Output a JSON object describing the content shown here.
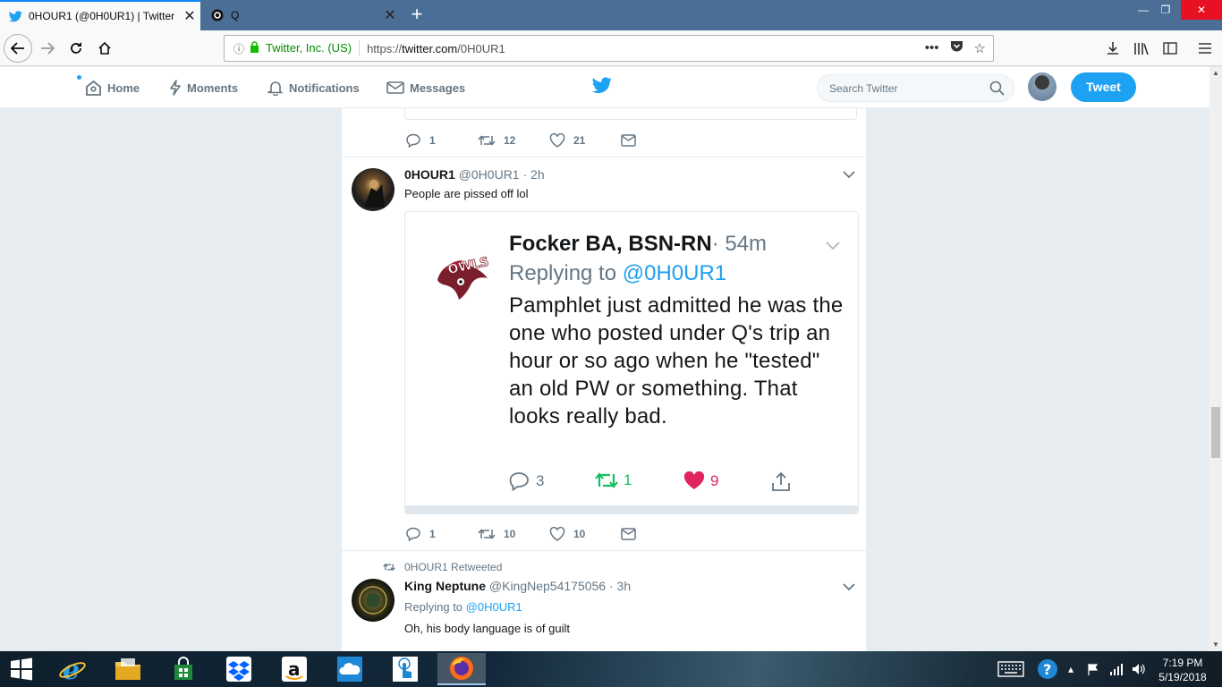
{
  "browser": {
    "tabs": [
      {
        "title": "0HOUR1 (@0H0UR1) | Twitter",
        "active": true
      },
      {
        "title": "Q",
        "active": false
      }
    ],
    "identity": "Twitter, Inc. (US)",
    "url_prefix": "https://",
    "url_host": "twitter.com",
    "url_path": "/0H0UR1",
    "page_actions_icon": "•••"
  },
  "twitter_header": {
    "nav": [
      {
        "label": "Home",
        "icon": "home-icon"
      },
      {
        "label": "Moments",
        "icon": "lightning-icon"
      },
      {
        "label": "Notifications",
        "icon": "bell-icon"
      },
      {
        "label": "Messages",
        "icon": "envelope-icon"
      }
    ],
    "search_placeholder": "Search Twitter",
    "tweet_button": "Tweet"
  },
  "prev_tweet_actions": {
    "replies": "1",
    "retweets": "12",
    "likes": "21"
  },
  "tweet1": {
    "fullname": "0HOUR1",
    "handle": "@0H0UR1",
    "time": "· 2h",
    "text": "People are pissed off lol",
    "actions": {
      "replies": "1",
      "retweets": "10",
      "likes": "10"
    },
    "embedded": {
      "name": "Focker BA, BSN-RN",
      "time": "· 54m",
      "replying_prefix": "Replying to",
      "replying_to": "@0H0UR1",
      "text": "Pamphlet just admitted he was the one who posted under Q's trip an hour or so ago when he \"tested\" an old PW or something. That looks really bad.",
      "replies": "3",
      "retweets": "1",
      "likes": "9"
    }
  },
  "tweet2": {
    "retweeted_by": "0HOUR1 Retweeted",
    "fullname": "King Neptune",
    "handle": "@KingNep54175056",
    "time": "· 3h",
    "replying_prefix": "Replying to",
    "replying_to": "@0H0UR1",
    "text": "Oh, his body language is of guilt"
  },
  "colors": {
    "twitter_blue": "#1da1f2",
    "retweet_green": "#17bf63",
    "like_red": "#e0245e"
  },
  "taskbar": {
    "icons": [
      "windows-start-icon",
      "internet-explorer-icon",
      "file-explorer-icon",
      "store-icon",
      "dropbox-icon",
      "amazon-icon",
      "onedrive-icon",
      "touch-icon",
      "firefox-icon"
    ],
    "clock_time": "7:19 PM",
    "clock_date": "5/19/2018"
  }
}
